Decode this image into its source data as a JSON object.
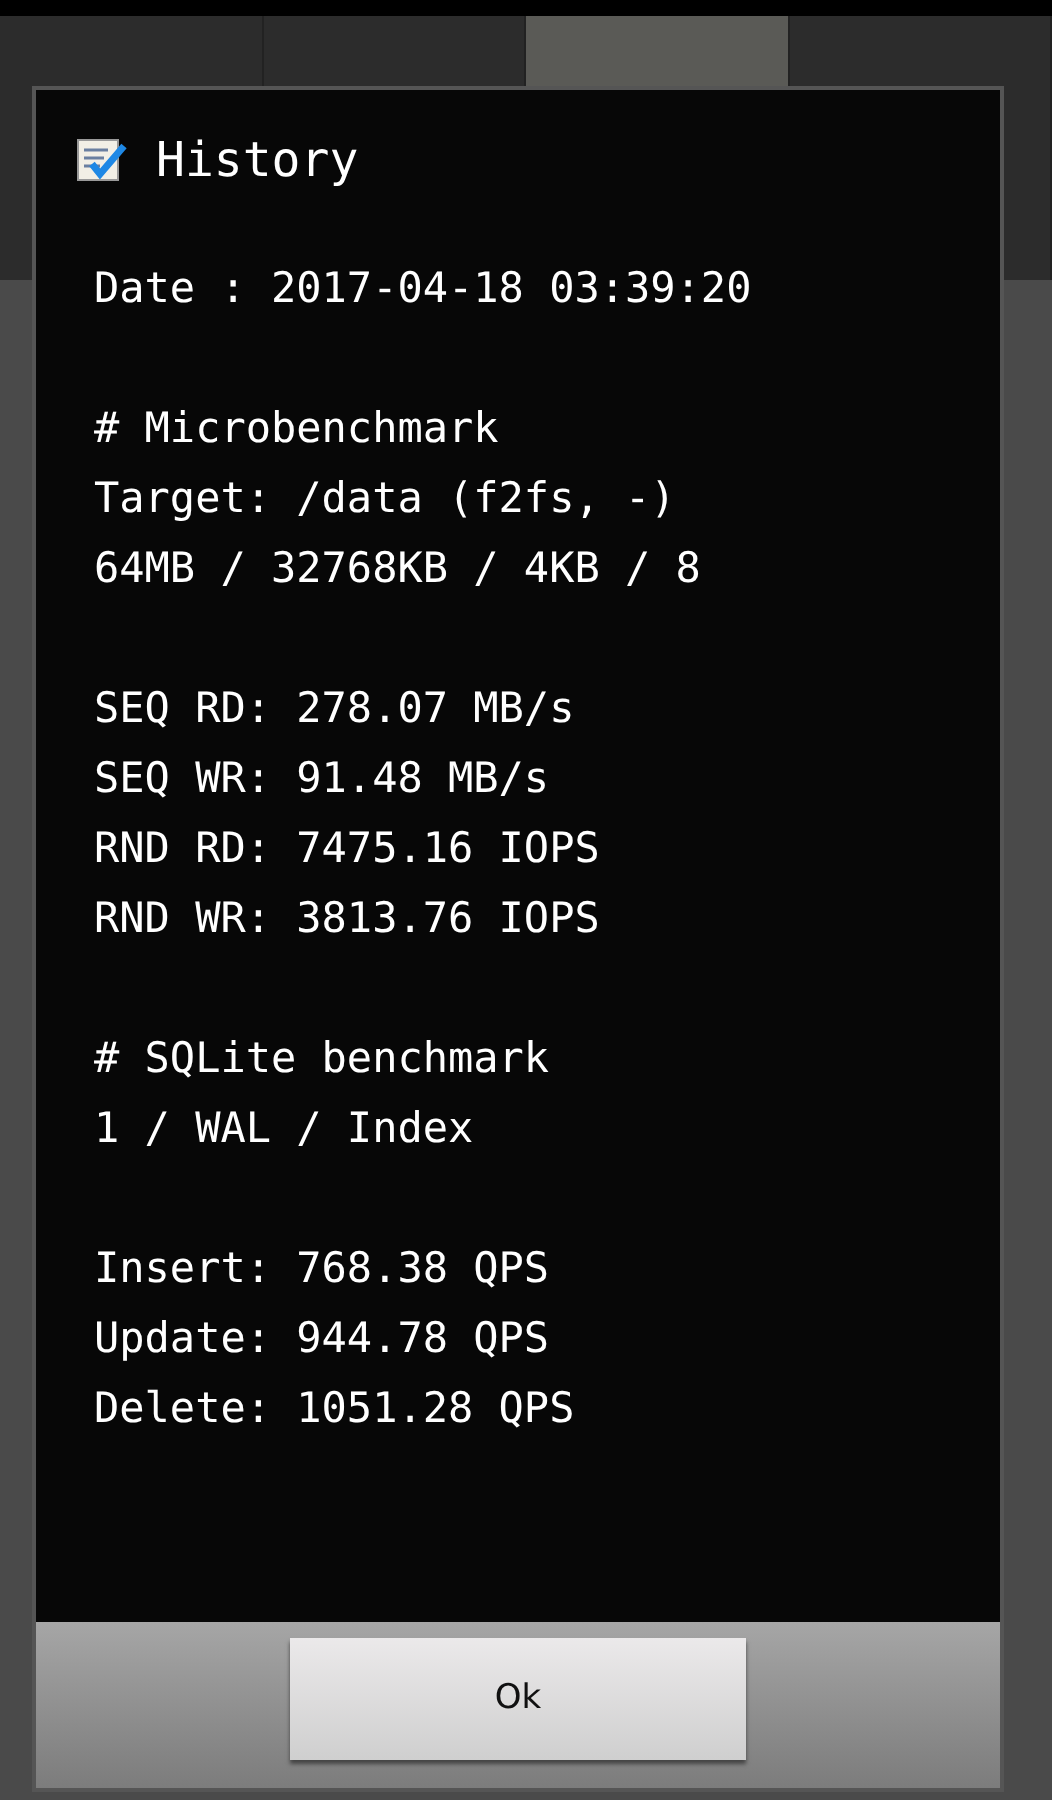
{
  "tabs": [
    {
      "selected": false
    },
    {
      "selected": false
    },
    {
      "selected": true
    },
    {
      "selected": false
    }
  ],
  "dialog": {
    "title": "History",
    "groups": [
      [
        "Date : 2017-04-18 03:39:20"
      ],
      [
        "# Microbenchmark",
        "Target: /data (f2fs, -)",
        "64MB / 32768KB / 4KB / 8"
      ],
      [
        "SEQ RD: 278.07 MB/s",
        "SEQ WR: 91.48 MB/s",
        "RND RD: 7475.16 IOPS",
        "RND WR: 3813.76 IOPS"
      ],
      [
        "# SQLite benchmark",
        "1 / WAL / Index"
      ],
      [
        "Insert: 768.38 QPS",
        "Update: 944.78 QPS",
        "Delete: 1051.28 QPS"
      ]
    ],
    "button": "Ok"
  }
}
